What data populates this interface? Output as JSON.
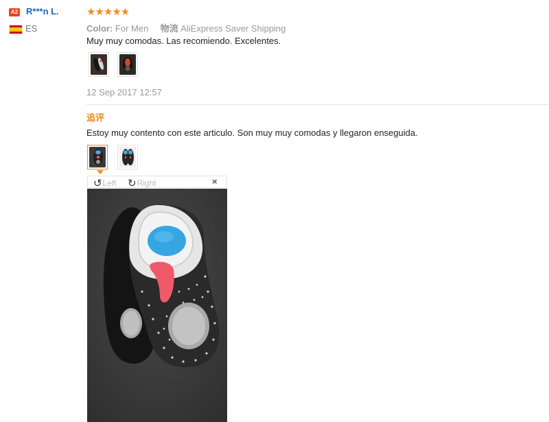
{
  "reviewer": {
    "level_badge": "A2",
    "name": "R***n L.",
    "country": "ES"
  },
  "review": {
    "rating": 5,
    "stars_text": "★★★★★",
    "color_label": "Color:",
    "color_value": "For Men",
    "shipping_label": "物流",
    "shipping_value": "AliExpress Saver Shipping",
    "text": "Muy muy comodas. Las recomiendo. Excelentes.",
    "date": "12 Sep 2017 12:57",
    "followup_label": "追评",
    "followup_text": "Estoy muy contento con este articulo. Son muy muy comodas y llegaron enseguida."
  },
  "viewer": {
    "rotate_left_label": "Left",
    "rotate_right_label": "Right",
    "close_label": "×"
  },
  "colors": {
    "accent": "#f28c1b",
    "username": "#1a66b8",
    "badge": "#e8451e"
  }
}
